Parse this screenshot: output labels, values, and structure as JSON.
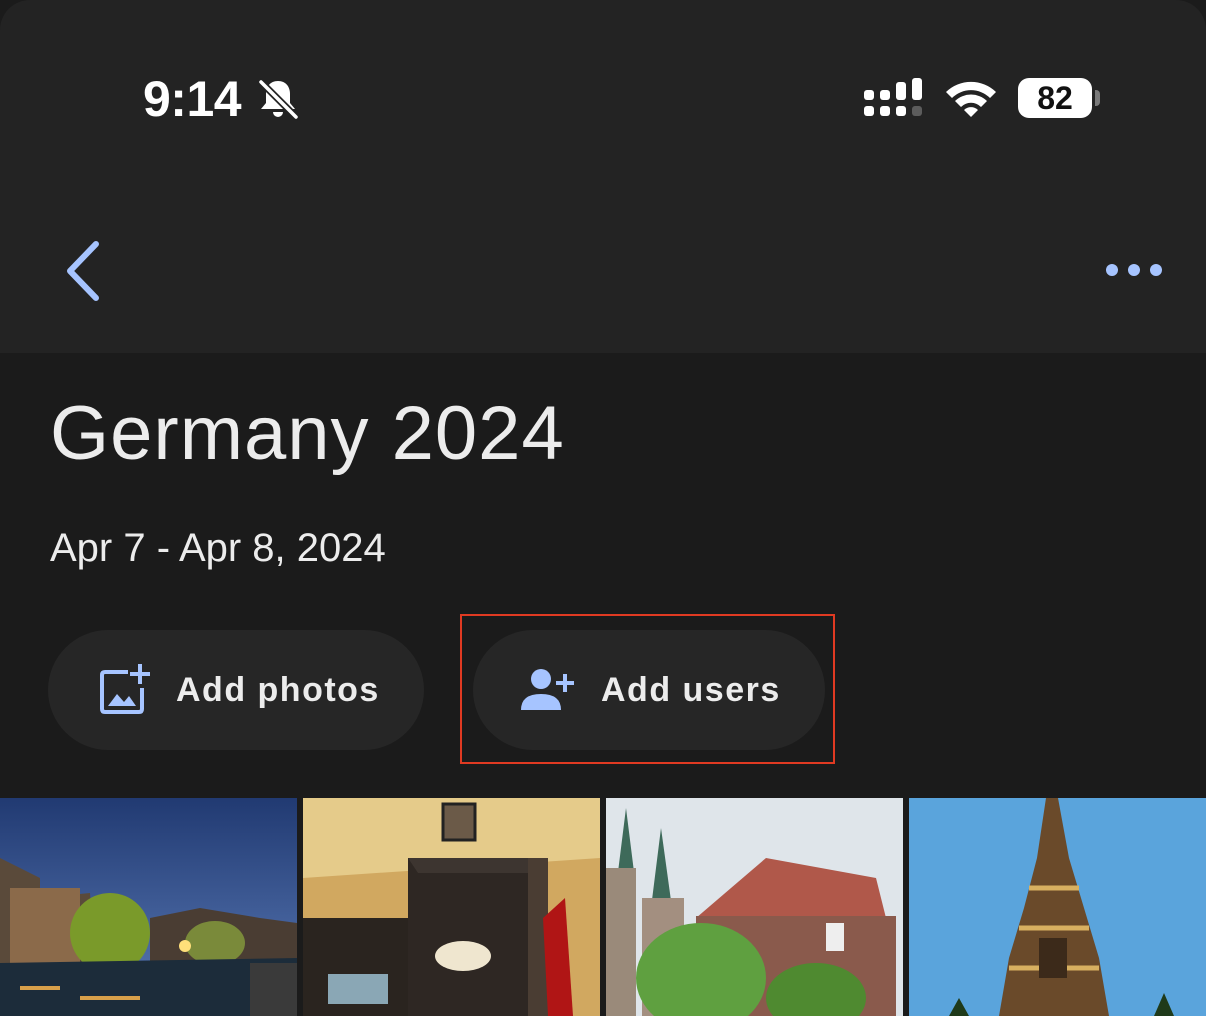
{
  "status_bar": {
    "time": "9:14",
    "battery": "82"
  },
  "nav": {
    "back_icon": "chevron-left-icon",
    "more_icon": "more-horizontal-icon",
    "accent_color": "#a6c4ff"
  },
  "album": {
    "title": "Germany 2024",
    "date_range": "Apr 7 - Apr 8, 2024"
  },
  "actions": {
    "add_photos": "Add photos",
    "add_users": "Add users"
  },
  "photos": [
    {
      "subject": "river-at-dusk"
    },
    {
      "subject": "restaurant-interior"
    },
    {
      "subject": "gothic-church"
    },
    {
      "subject": "ornate-fountain-spire"
    }
  ]
}
